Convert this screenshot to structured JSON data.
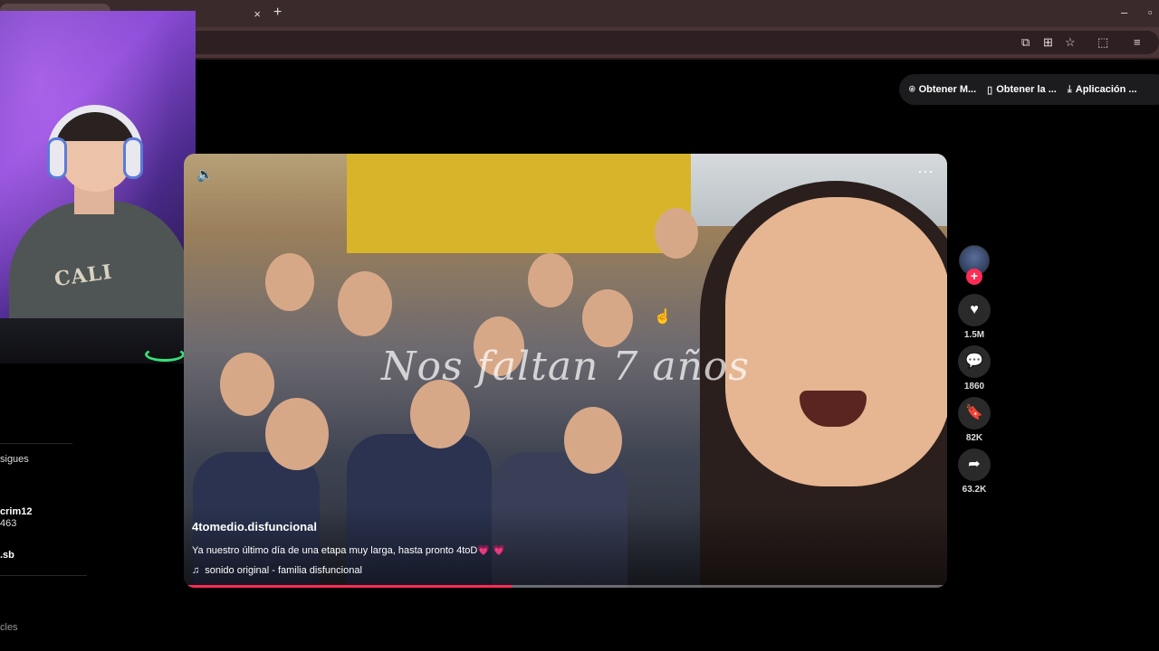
{
  "browser": {
    "tabs": [
      {
        "label": "..."
      },
      {
        "label": ""
      }
    ],
    "new_tab": "+",
    "close": "×"
  },
  "actions": [
    {
      "icon": "⍟",
      "label": "Obtener M..."
    },
    {
      "icon": "▯",
      "label": "Obtener la ..."
    },
    {
      "icon": "⤓",
      "label": "Aplicación ..."
    }
  ],
  "sidebar": {
    "dot": "...",
    "following": "sigues",
    "user1": "crim12",
    "user1_sub": "463",
    "user2": ".sb",
    "bottom": "cles"
  },
  "video": {
    "overlay_text": "Nos faltan 7 años",
    "author": "4tomedio.disfuncional",
    "caption": "Ya nuestro último día de una etapa muy larga, hasta pronto 4toD💗 💗",
    "sound": "sonido original - familia disfuncional",
    "progress": 0.43
  },
  "rail": {
    "likes": "1.5M",
    "comments": "1860",
    "saves": "82K",
    "shares": "63.2K"
  }
}
